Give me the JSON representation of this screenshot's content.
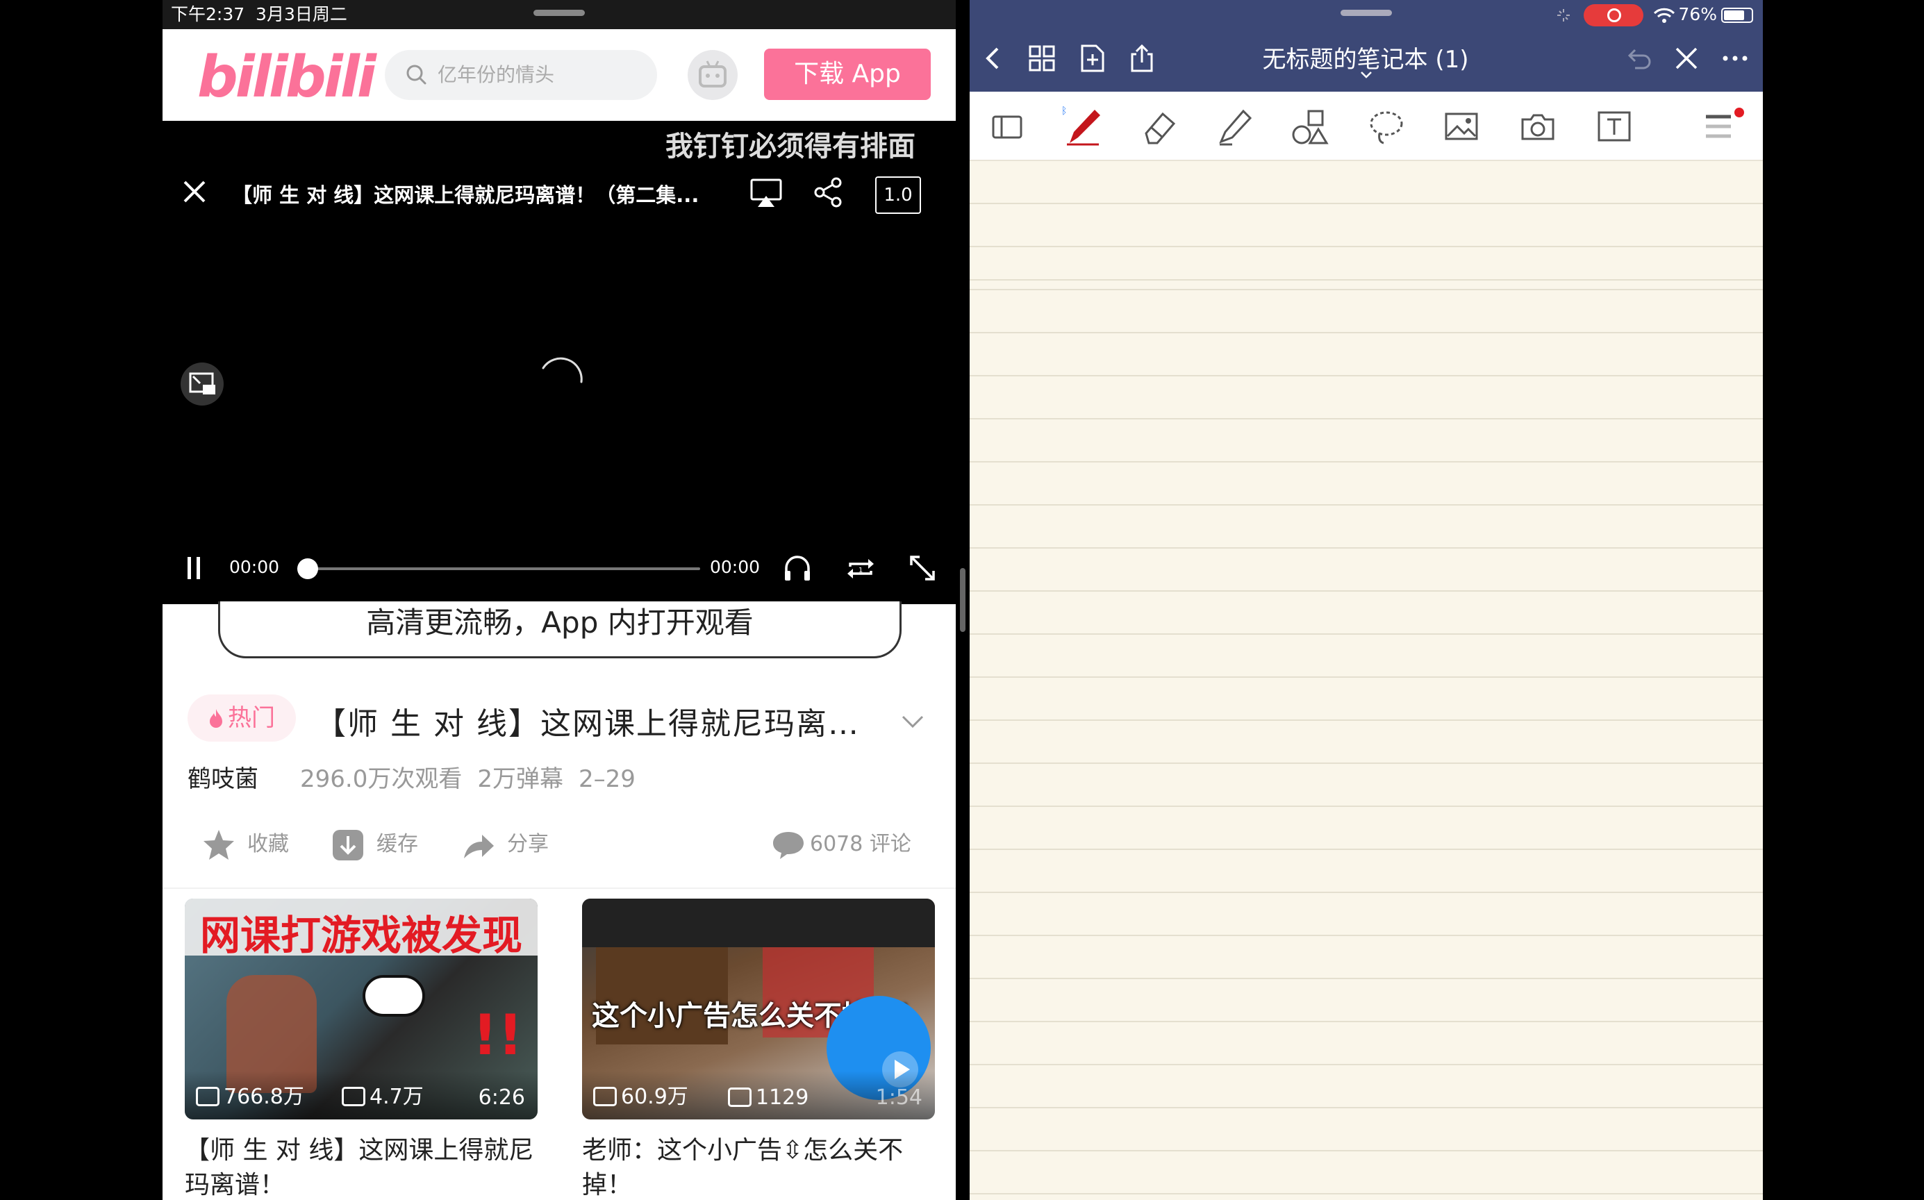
{
  "left_pane": {
    "status_bar": {
      "time": "下午2:37",
      "date": "3月3日周二"
    },
    "header": {
      "logo": "bilibili",
      "search_placeholder": "亿年份的情头",
      "download_button": "下载 App"
    },
    "player": {
      "danmaku": "我钉钉必须得有排面",
      "title": "【师 生 对 线】这网课上得就尼玛离谱！（第二集...",
      "speed": "1.0",
      "current_time": "00:00",
      "duration": "00:00",
      "progress": 0
    },
    "banner": "高清更流畅，App 内打开观看",
    "video_info": {
      "hot_badge": "热门",
      "title": "【师 生 对 线】这网课上得就尼玛离谱！（第二集",
      "uploader": "鹤吱菌",
      "views": "296.0万次观看",
      "danmaku_count": "2万弹幕",
      "date": "2–29"
    },
    "actions": {
      "favorite": "收藏",
      "cache": "缓存",
      "share": "分享",
      "comments": "6078 评论"
    },
    "recommendations": [
      {
        "thumb_caption": "网课打游戏被发现",
        "views": "766.8万",
        "danmaku": "4.7万",
        "duration": "6:26",
        "title": "【师 生 对 线】这网课上得就尼玛离谱！"
      },
      {
        "thumb_caption": "这个小广告怎么关不掉？！",
        "views": "60.9万",
        "danmaku": "1129",
        "duration": "1:54",
        "title": "老师：这个小广告⇳怎么关不掉！"
      }
    ]
  },
  "right_pane": {
    "status_bar": {
      "battery": "76%",
      "battery_level": 0.76
    },
    "header": {
      "title": "无标题的笔记本 (1)"
    },
    "tools": [
      "sidebar-icon",
      "pen-icon",
      "eraser-icon",
      "highlighter-icon",
      "shapes-icon",
      "lasso-icon",
      "image-icon",
      "camera-icon",
      "textbox-icon",
      "more-tools-icon"
    ],
    "colors": {
      "header_bg": "#3c4876",
      "paper": "#faf6ea",
      "pen": "#c4161c"
    }
  },
  "colors": {
    "bili_pink": "#fb7299"
  }
}
